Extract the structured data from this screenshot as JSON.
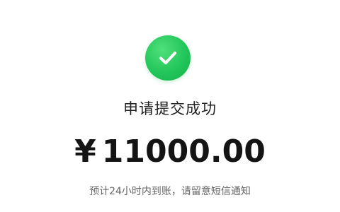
{
  "status": {
    "icon": "check-circle-icon",
    "accent_color": "#22c65a",
    "title": "申请提交成功"
  },
  "amount": {
    "currency_symbol": "¥",
    "value": "11000.00"
  },
  "note": "预计24小时内到账，请留意短信通知"
}
